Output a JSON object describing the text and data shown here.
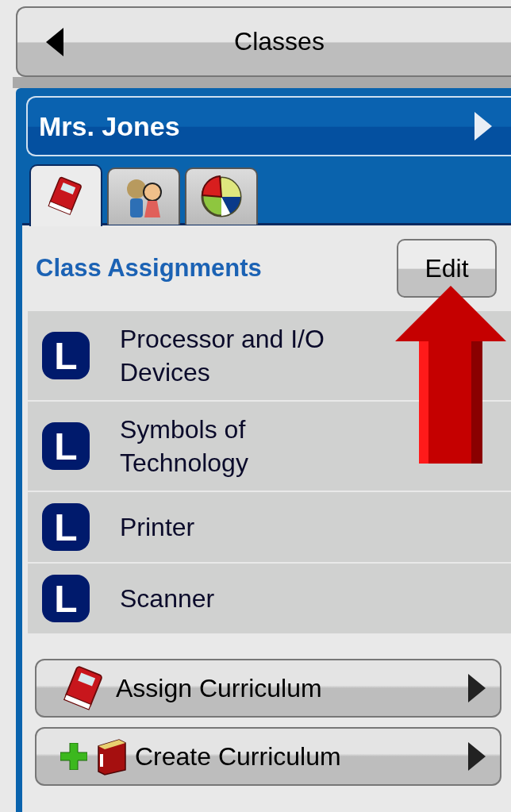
{
  "header": {
    "title": "Classes"
  },
  "teacher": {
    "name": "Mrs. Jones"
  },
  "tabs": [
    {
      "kind": "book",
      "selected": true
    },
    {
      "kind": "people",
      "selected": false
    },
    {
      "kind": "pie",
      "selected": false
    }
  ],
  "section": {
    "title": "Class Assignments",
    "edit_button": "Edit"
  },
  "assignments": [
    {
      "badge": "L",
      "title": "Processor and I/O Devices"
    },
    {
      "badge": "L",
      "title": "Symbols of Technology"
    },
    {
      "badge": "L",
      "title": "Printer"
    },
    {
      "badge": "L",
      "title": "Scanner"
    }
  ],
  "actions": [
    {
      "kind": "assign",
      "label": "Assign Curriculum"
    },
    {
      "kind": "create",
      "label": "Create Curriculum"
    }
  ]
}
